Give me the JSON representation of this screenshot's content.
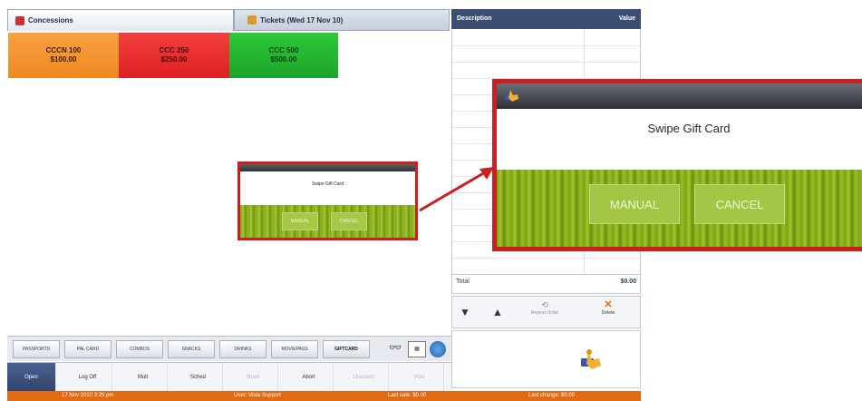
{
  "colors": {
    "accent": "#3c4f72",
    "status_bar": "#e36a10",
    "highlight": "#cc1f1f"
  },
  "tabs": [
    {
      "label": "Concessions",
      "icon": "concessions-icon"
    },
    {
      "label": "Tickets (Wed 17 Nov 10)",
      "icon": "tickets-icon"
    }
  ],
  "products": [
    {
      "name": "CCCN 100",
      "price": "$100.00"
    },
    {
      "name": "CCC 250",
      "price": "$250.00"
    },
    {
      "name": "CCC 500",
      "price": "$500.00"
    }
  ],
  "order_panel": {
    "col_description": "Description",
    "col_value": "Value",
    "total_label": "Total",
    "total_value": "$0.00",
    "repeat_label": "Repeat Order",
    "delete_label": "Delete"
  },
  "categories": [
    "PASSPORTS",
    "PAL CARD",
    "COMBOS",
    "SNACKS",
    "DRINKS",
    "MOVIEPASS",
    "GIFTCARD"
  ],
  "actions": [
    "Open",
    "Log Off",
    "Mult",
    "Sched",
    "Book",
    "Abort",
    "Discount",
    "Void"
  ],
  "status": {
    "datetime": "17 Nov 2010 3:29 pm",
    "user": "User: Vista Support",
    "last_sale": "Last sale: $0.00",
    "last_change": "Last change: $0.00"
  },
  "dialog": {
    "title": "Swipe Gift Card",
    "manual": "MANUAL",
    "cancel": "CANCEL"
  }
}
